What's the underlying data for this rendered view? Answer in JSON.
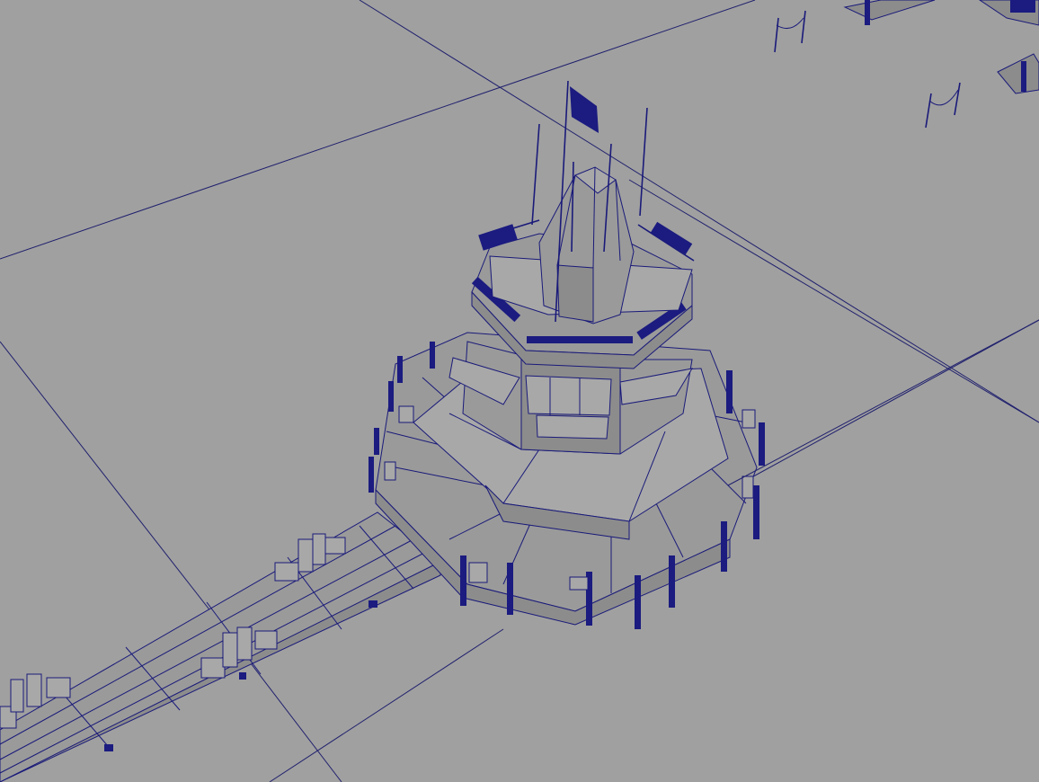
{
  "viewport": {
    "background_color": "#a0a0a0",
    "wire_color": "#1a1a7a",
    "display_mode": "wireframe-on-shaded"
  },
  "objects": [
    {
      "name": "control-tower",
      "icon": "octagonal-tower"
    },
    {
      "name": "flag-pole",
      "icon": "flag"
    },
    {
      "name": "walkway-bridge",
      "icon": "walkway"
    },
    {
      "name": "bollard-posts",
      "icon": "post"
    },
    {
      "name": "railing-fence",
      "icon": "fence"
    }
  ]
}
